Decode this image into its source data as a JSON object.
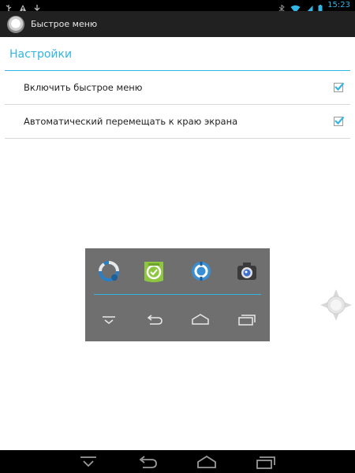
{
  "status_bar": {
    "left_icons": [
      "usb-icon",
      "warning-icon",
      "download-icon"
    ],
    "right_icons": [
      "bluetooth-icon",
      "wifi-icon",
      "signal-icon",
      "battery-icon"
    ],
    "time": "15:23"
  },
  "action_bar": {
    "icon": "quick-menu-app-icon",
    "title": "Быстрое меню"
  },
  "settings": {
    "section_title": "Настройки",
    "items": [
      {
        "label": "Включить быстрое меню",
        "checked": true
      },
      {
        "label": "Автоматический перемещать к краю экрана",
        "checked": true
      }
    ]
  },
  "quick_menu": {
    "apps": [
      "sync-app-icon",
      "android-sync-app-icon",
      "backup-app-icon",
      "camera-app-icon"
    ],
    "nav": [
      "menu-down-icon",
      "back-icon",
      "home-icon",
      "recent-apps-icon"
    ]
  },
  "system_nav": [
    "hide-keyboard-icon",
    "back-icon",
    "home-icon",
    "recent-apps-icon"
  ],
  "colors": {
    "accent": "#33b5e5",
    "action_bar": "#212121",
    "quick_menu_bg": "#6f6f6f"
  }
}
